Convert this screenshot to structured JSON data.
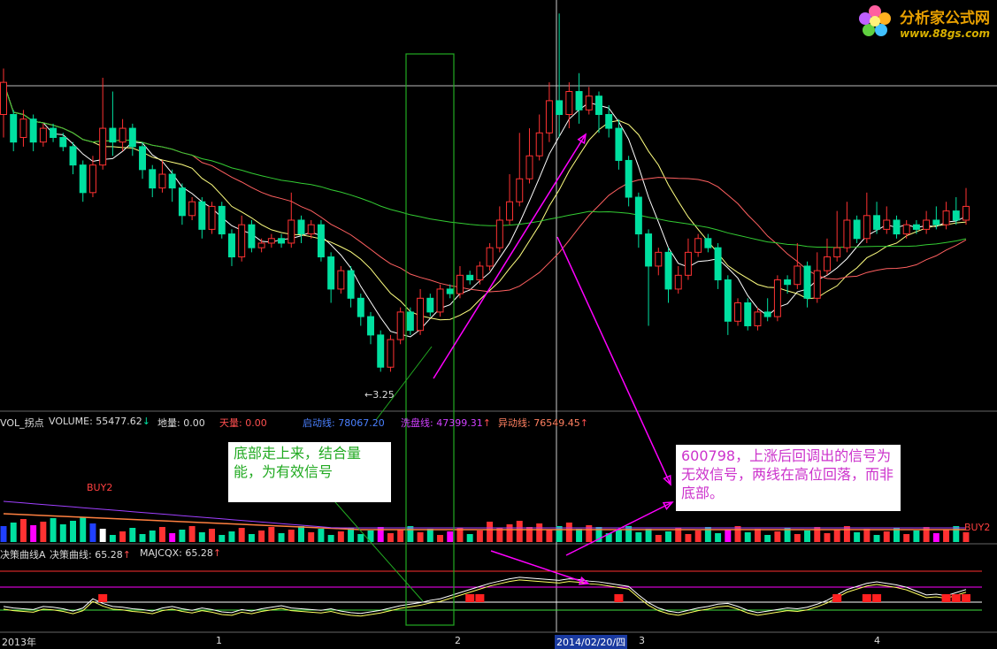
{
  "logo": {
    "name": "分析家公式网",
    "url": "www.88gs.com"
  },
  "price_low_label": "3.25",
  "volume_header": {
    "prefix": "VOL_拐点",
    "volume": "VOLUME: 55477.62",
    "earth": "地量: 0.00",
    "sky": "天量: 0.00",
    "start": "启动线: 78067.20",
    "wash": "洗盘线: 47399.31",
    "anomaly": "异动线: 76549.45"
  },
  "buy_labels": [
    "BUY2",
    "BUY2"
  ],
  "decision_header": {
    "a": "决策曲线A",
    "b": "决策曲线: 65.28",
    "c": "MAJCQX: 65.28"
  },
  "notes": {
    "left": "底部走上来，结合量能，为有效信号",
    "right": "600798，上涨后回调出的信号为无效信号，两线在高位回落，而非底部。"
  },
  "x_axis": {
    "year": "2013年",
    "m1": "1",
    "m2": "2",
    "m3": "3",
    "m4": "4",
    "date": "2014/02/20/四"
  },
  "colors": {
    "up": "#ff3232",
    "down": "#00e0a0",
    "ma5": "#ffffff",
    "ma10": "#ffff80",
    "ma20": "#ff6060",
    "ma60": "#33cc33",
    "arrow": "#ff00ff",
    "box": "#22aa22"
  },
  "chart_data": {
    "type": "candlestick",
    "title": "",
    "candles": [
      [
        8.9,
        9.6,
        8.4,
        9.9
      ],
      [
        8.9,
        8.3,
        8.1,
        9.0
      ],
      [
        8.4,
        8.8,
        8.2,
        9.0
      ],
      [
        8.8,
        8.3,
        8.1,
        8.9
      ],
      [
        8.3,
        8.6,
        8.2,
        8.7
      ],
      [
        8.6,
        8.4,
        8.3,
        8.7
      ],
      [
        8.4,
        8.2,
        8.1,
        8.5
      ],
      [
        8.2,
        7.8,
        7.6,
        8.3
      ],
      [
        7.8,
        7.2,
        7.0,
        7.9
      ],
      [
        7.2,
        7.8,
        7.1,
        8.0
      ],
      [
        7.8,
        8.6,
        7.7,
        9.7
      ],
      [
        8.6,
        8.3,
        8.0,
        9.4
      ],
      [
        8.3,
        8.6,
        8.1,
        8.8
      ],
      [
        8.6,
        8.2,
        8.0,
        8.7
      ],
      [
        8.2,
        7.7,
        7.5,
        8.3
      ],
      [
        7.7,
        7.3,
        7.1,
        7.8
      ],
      [
        7.3,
        7.6,
        7.2,
        7.9
      ],
      [
        7.6,
        7.3,
        7.0,
        7.7
      ],
      [
        7.3,
        6.7,
        6.5,
        7.4
      ],
      [
        6.7,
        7.0,
        6.6,
        7.1
      ],
      [
        7.0,
        6.4,
        6.2,
        7.1
      ],
      [
        6.4,
        6.9,
        6.3,
        7.0
      ],
      [
        6.9,
        6.3,
        6.2,
        7.0
      ],
      [
        6.3,
        5.8,
        5.6,
        6.4
      ],
      [
        5.8,
        6.5,
        5.7,
        6.7
      ],
      [
        6.5,
        6.0,
        5.9,
        6.6
      ],
      [
        6.0,
        6.1,
        5.9,
        6.2
      ],
      [
        6.1,
        6.2,
        6.0,
        6.3
      ],
      [
        6.2,
        6.1,
        6.0,
        6.3
      ],
      [
        6.1,
        6.6,
        6.0,
        7.2
      ],
      [
        6.6,
        6.3,
        6.1,
        6.7
      ],
      [
        6.3,
        6.5,
        6.2,
        6.6
      ],
      [
        6.5,
        5.8,
        5.7,
        6.6
      ],
      [
        5.8,
        5.1,
        4.8,
        5.9
      ],
      [
        5.1,
        5.5,
        5.0,
        5.6
      ],
      [
        5.5,
        4.9,
        4.7,
        5.6
      ],
      [
        4.9,
        4.5,
        4.3,
        5.0
      ],
      [
        4.5,
        4.1,
        3.9,
        4.6
      ],
      [
        4.1,
        3.4,
        3.3,
        4.2
      ],
      [
        3.4,
        4.0,
        3.3,
        4.1
      ],
      [
        4.0,
        4.6,
        3.9,
        4.7
      ],
      [
        4.6,
        4.2,
        4.1,
        4.7
      ],
      [
        4.2,
        4.9,
        4.1,
        5.1
      ],
      [
        4.9,
        4.6,
        4.5,
        5.0
      ],
      [
        4.6,
        5.1,
        4.5,
        5.2
      ],
      [
        5.1,
        5.0,
        4.9,
        5.2
      ],
      [
        5.0,
        5.4,
        4.9,
        5.6
      ],
      [
        5.4,
        5.3,
        5.2,
        5.5
      ],
      [
        5.3,
        5.6,
        5.2,
        5.7
      ],
      [
        5.6,
        6.0,
        5.5,
        6.1
      ],
      [
        6.0,
        6.6,
        5.9,
        6.9
      ],
      [
        6.6,
        7.0,
        6.5,
        7.6
      ],
      [
        7.0,
        7.5,
        6.9,
        8.5
      ],
      [
        7.5,
        8.0,
        7.4,
        8.6
      ],
      [
        8.0,
        8.5,
        7.9,
        8.9
      ],
      [
        8.5,
        9.2,
        8.3,
        9.6
      ],
      [
        9.2,
        8.9,
        8.4,
        11.1
      ],
      [
        8.9,
        9.4,
        8.6,
        9.6
      ],
      [
        9.4,
        9.0,
        8.7,
        9.8
      ],
      [
        9.0,
        9.3,
        8.9,
        9.5
      ],
      [
        9.3,
        8.9,
        8.5,
        9.4
      ],
      [
        8.9,
        8.6,
        8.4,
        9.1
      ],
      [
        8.6,
        7.9,
        7.7,
        8.8
      ],
      [
        7.9,
        7.1,
        6.9,
        8.0
      ],
      [
        7.1,
        6.3,
        6.0,
        7.2
      ],
      [
        6.3,
        5.6,
        4.3,
        6.4
      ],
      [
        5.6,
        5.9,
        5.4,
        6.0
      ],
      [
        5.9,
        5.1,
        4.8,
        6.0
      ],
      [
        5.1,
        5.4,
        5.0,
        5.6
      ],
      [
        5.4,
        5.9,
        5.3,
        6.2
      ],
      [
        5.9,
        6.2,
        5.8,
        6.3
      ],
      [
        6.2,
        6.0,
        5.9,
        6.3
      ],
      [
        6.0,
        5.3,
        5.1,
        6.1
      ],
      [
        5.3,
        4.4,
        4.1,
        5.4
      ],
      [
        4.4,
        4.8,
        4.3,
        4.9
      ],
      [
        4.8,
        4.3,
        4.2,
        4.9
      ],
      [
        4.3,
        4.6,
        4.2,
        4.7
      ],
      [
        4.6,
        4.5,
        4.4,
        4.9
      ],
      [
        4.5,
        5.3,
        4.4,
        5.4
      ],
      [
        5.3,
        5.2,
        5.0,
        5.4
      ],
      [
        5.2,
        5.6,
        5.1,
        6.1
      ],
      [
        5.6,
        4.9,
        4.7,
        5.7
      ],
      [
        4.9,
        5.5,
        4.8,
        5.9
      ],
      [
        5.5,
        5.8,
        5.4,
        6.2
      ],
      [
        5.8,
        6.0,
        5.7,
        6.8
      ],
      [
        6.0,
        6.6,
        5.9,
        7.0
      ],
      [
        6.6,
        6.2,
        6.1,
        6.7
      ],
      [
        6.2,
        6.7,
        6.1,
        7.2
      ],
      [
        6.7,
        6.4,
        6.3,
        7.0
      ],
      [
        6.4,
        6.6,
        6.3,
        6.9
      ],
      [
        6.6,
        6.3,
        6.2,
        6.7
      ],
      [
        6.3,
        6.5,
        6.2,
        6.6
      ],
      [
        6.5,
        6.4,
        6.3,
        6.6
      ],
      [
        6.4,
        6.6,
        6.3,
        6.8
      ],
      [
        6.6,
        6.5,
        6.4,
        6.9
      ],
      [
        6.5,
        6.8,
        6.4,
        7.0
      ],
      [
        6.8,
        6.6,
        6.5,
        7.1
      ],
      [
        6.6,
        6.9,
        6.5,
        7.3
      ]
    ],
    "candle_order": "open,close,low,high",
    "decision_curve": [
      30,
      28,
      27,
      26,
      30,
      29,
      27,
      24,
      28,
      40,
      34,
      30,
      29,
      27,
      26,
      24,
      28,
      30,
      27,
      25,
      28,
      26,
      23,
      22,
      26,
      24,
      27,
      29,
      31,
      28,
      27,
      26,
      25,
      27,
      24,
      22,
      21,
      23,
      25,
      28,
      31,
      33,
      35,
      38,
      40,
      44,
      48,
      52,
      56,
      60,
      63,
      66,
      68,
      67,
      66,
      65,
      64,
      66,
      65,
      63,
      62,
      60,
      58,
      56,
      45,
      35,
      28,
      24,
      22,
      25,
      28,
      30,
      33,
      34,
      30,
      25,
      22,
      24,
      26,
      28,
      27,
      29,
      33,
      38,
      45,
      52,
      56,
      60,
      62,
      60,
      58,
      55,
      50,
      45,
      46,
      44,
      48,
      52
    ]
  }
}
